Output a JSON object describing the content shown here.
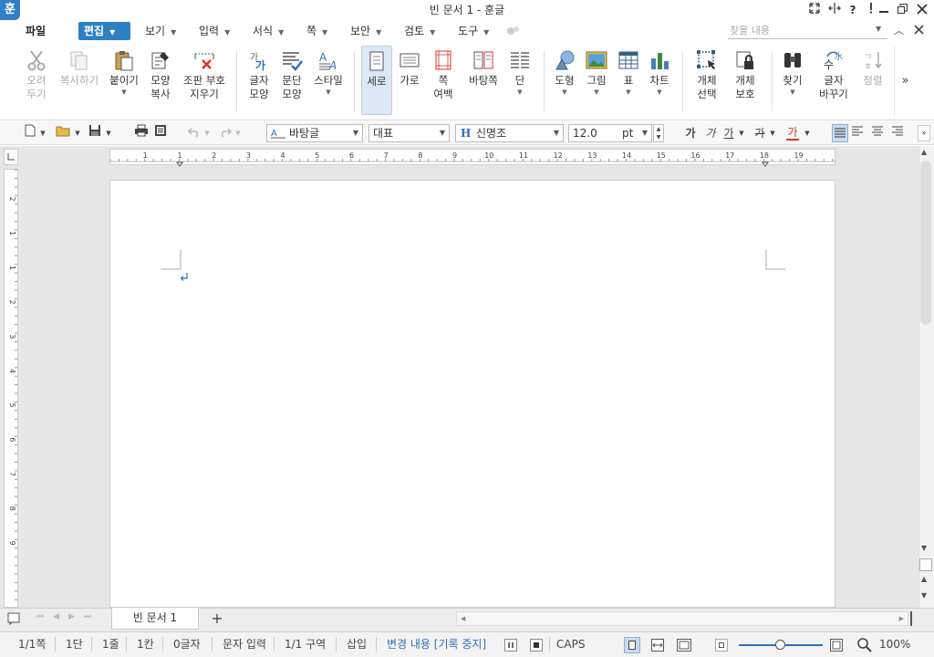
{
  "window": {
    "title": "빈 문서 1 - 훈글",
    "logo": "훈"
  },
  "menu": {
    "file": "파일",
    "items": [
      {
        "label": "편집",
        "name": "edit"
      },
      {
        "label": "보기",
        "name": "view"
      },
      {
        "label": "입력",
        "name": "input"
      },
      {
        "label": "서식",
        "name": "format"
      },
      {
        "label": "쪽",
        "name": "page"
      },
      {
        "label": "보안",
        "name": "security"
      },
      {
        "label": "검토",
        "name": "review"
      },
      {
        "label": "도구",
        "name": "tools"
      }
    ],
    "search_placeholder": "찾을 내용"
  },
  "ribbon": {
    "cut": "오려\n두기",
    "copy": "복사하기",
    "paste": "붙이기",
    "format_copy": "모양\n복사",
    "clear_codes": "조판 부호\n지우기",
    "char_shape": "글자\n모양",
    "para_shape": "문단\n모양",
    "style": "스타일",
    "portrait": "세로",
    "landscape": "가로",
    "margins": "쪽\n여백",
    "background": "바탕쪽",
    "columns": "단",
    "shapes": "도형",
    "picture": "그림",
    "table": "표",
    "chart": "차트",
    "select_object": "개체\n선택",
    "protect_object": "개체\n보호",
    "find": "찾기",
    "replace": "글자\n바꾸기",
    "sort": "정렬"
  },
  "format": {
    "style": "바탕글",
    "lang": "대표",
    "font": "신명조",
    "size": "12.0",
    "unit": "pt",
    "bold": "가",
    "italic": "가",
    "underline": "가",
    "strike": "가",
    "color": "가"
  },
  "ruler": {
    "h_ticks": [
      "1",
      "1",
      "2",
      "3",
      "4",
      "5",
      "6",
      "7",
      "8",
      "9",
      "10",
      "11",
      "12",
      "13",
      "14",
      "15",
      "16",
      "17",
      "18",
      "19"
    ],
    "v_ticks": [
      "2",
      "1",
      "1",
      "2",
      "3",
      "4",
      "5",
      "6",
      "7",
      "8",
      "9"
    ]
  },
  "tabs": {
    "doc": "빈 문서 1",
    "add": "+"
  },
  "status": {
    "page": "1/1쪽",
    "column": "1단",
    "line": "1줄",
    "col": "1칸",
    "chars": "0글자",
    "mode": "문자 입력",
    "section": "1/1 구역",
    "insert": "삽입",
    "track": "변경 내용 [기록 중지]",
    "caps": "CAPS",
    "zoom": "100%"
  },
  "colors": {
    "accent": "#2f7fc4",
    "track": "#2f6fb8",
    "red": "#d9342b"
  }
}
